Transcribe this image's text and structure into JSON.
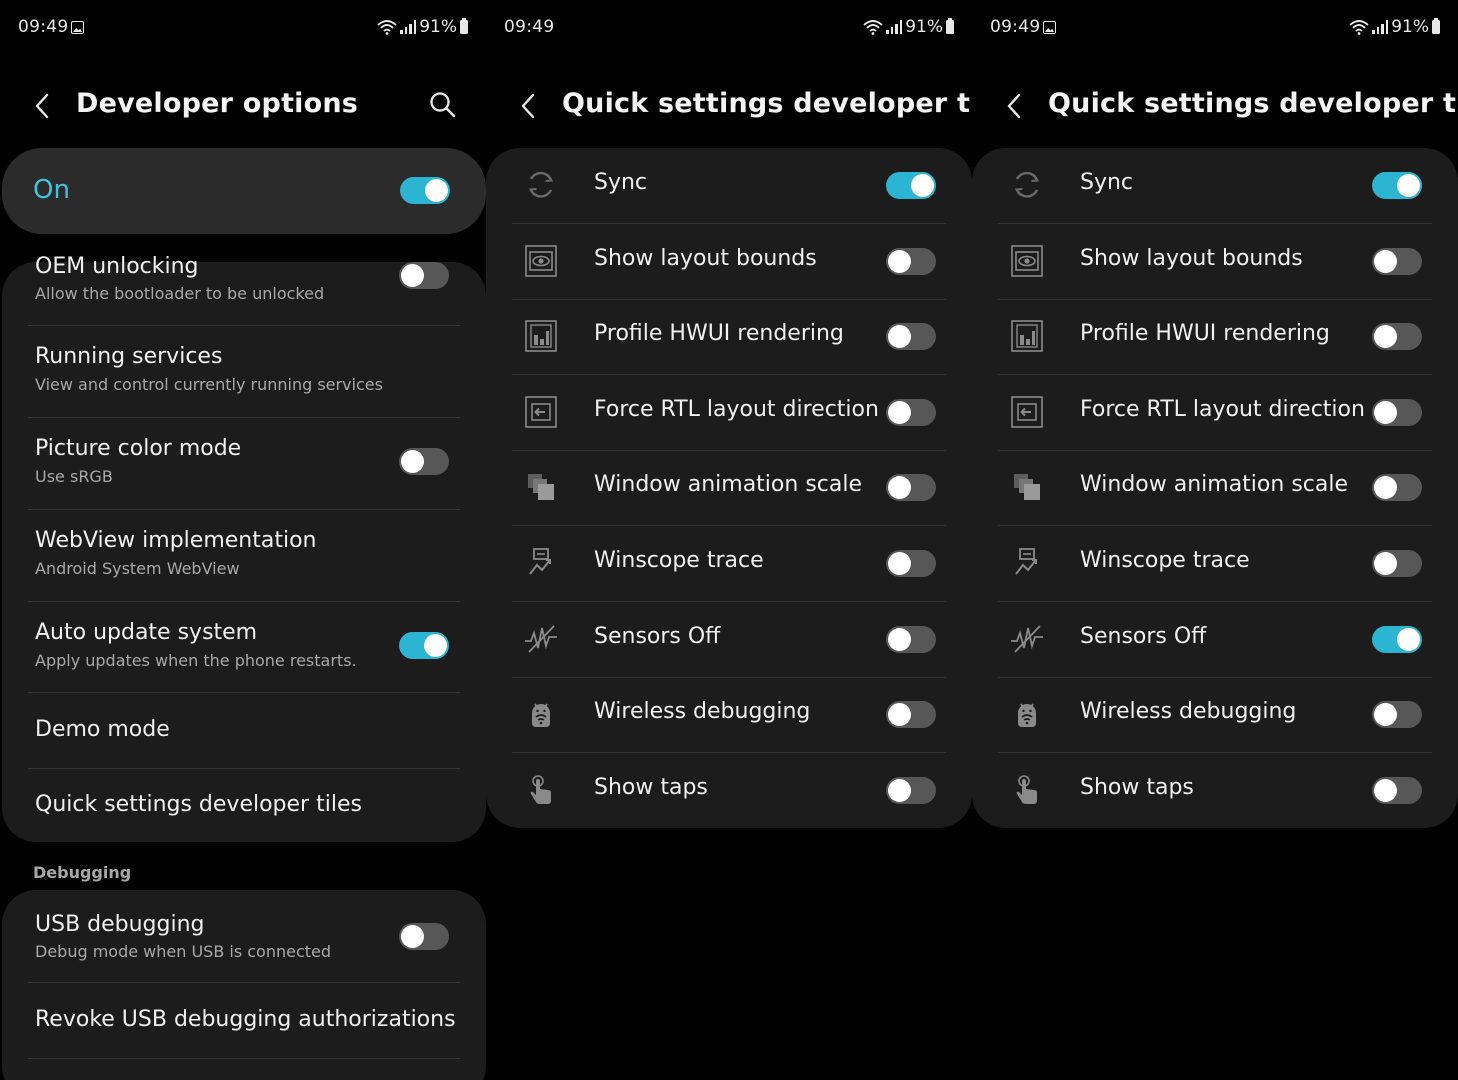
{
  "status_bar": {
    "time": "09:49",
    "battery": "91%"
  },
  "screen1": {
    "title": "Developer options",
    "master": {
      "label": "On",
      "on": true
    },
    "items": [
      {
        "title": "OEM unlocking",
        "subtitle": "Allow the bootloader to be unlocked",
        "has_toggle": true,
        "on": false
      },
      {
        "title": "Running services",
        "subtitle": "View and control currently running services",
        "has_toggle": false
      },
      {
        "title": "Picture color mode",
        "subtitle": "Use sRGB",
        "has_toggle": true,
        "on": false
      },
      {
        "title": "WebView implementation",
        "subtitle": "Android System WebView",
        "has_toggle": false
      },
      {
        "title": "Auto update system",
        "subtitle": "Apply updates when the phone restarts.",
        "has_toggle": true,
        "on": true
      },
      {
        "title": "Demo mode",
        "has_toggle": false
      },
      {
        "title": "Quick settings developer tiles",
        "has_toggle": false
      }
    ],
    "section": "Debugging",
    "debug_items": [
      {
        "title": "USB debugging",
        "subtitle": "Debug mode when USB is connected",
        "has_toggle": true,
        "on": false
      },
      {
        "title": "Revoke USB debugging authorizations",
        "has_toggle": false
      }
    ]
  },
  "screen2": {
    "title": "Quick settings developer tiles",
    "tiles": [
      {
        "label": "Sync",
        "icon": "sync-icon",
        "on": true
      },
      {
        "label": "Show layout bounds",
        "icon": "layout-bounds-icon",
        "on": false
      },
      {
        "label": "Profile HWUI rendering",
        "icon": "hwui-rendering-icon",
        "on": false
      },
      {
        "label": "Force RTL layout direction",
        "icon": "rtl-direction-icon",
        "on": false
      },
      {
        "label": "Window animation scale",
        "icon": "window-animation-icon",
        "on": false
      },
      {
        "label": "Winscope trace",
        "icon": "winscope-trace-icon",
        "on": false
      },
      {
        "label": "Sensors Off",
        "icon": "sensors-off-icon",
        "on": false
      },
      {
        "label": "Wireless debugging",
        "icon": "wireless-debugging-icon",
        "on": false
      },
      {
        "label": "Show taps",
        "icon": "show-taps-icon",
        "on": false
      }
    ]
  },
  "screen3": {
    "title": "Quick settings developer tiles",
    "tiles": [
      {
        "label": "Sync",
        "icon": "sync-icon",
        "on": true
      },
      {
        "label": "Show layout bounds",
        "icon": "layout-bounds-icon",
        "on": false
      },
      {
        "label": "Profile HWUI rendering",
        "icon": "hwui-rendering-icon",
        "on": false
      },
      {
        "label": "Force RTL layout direction",
        "icon": "rtl-direction-icon",
        "on": false
      },
      {
        "label": "Window animation scale",
        "icon": "window-animation-icon",
        "on": false
      },
      {
        "label": "Winscope trace",
        "icon": "winscope-trace-icon",
        "on": false
      },
      {
        "label": "Sensors Off",
        "icon": "sensors-off-icon",
        "on": true
      },
      {
        "label": "Wireless debugging",
        "icon": "wireless-debugging-icon",
        "on": false
      },
      {
        "label": "Show taps",
        "icon": "show-taps-icon",
        "on": false
      }
    ]
  },
  "colors": {
    "accent": "#2bb5d3",
    "on_label": "#3fc3df",
    "card": "#1c1c1c",
    "master_card": "#2b2b2b",
    "background": "#000000"
  }
}
